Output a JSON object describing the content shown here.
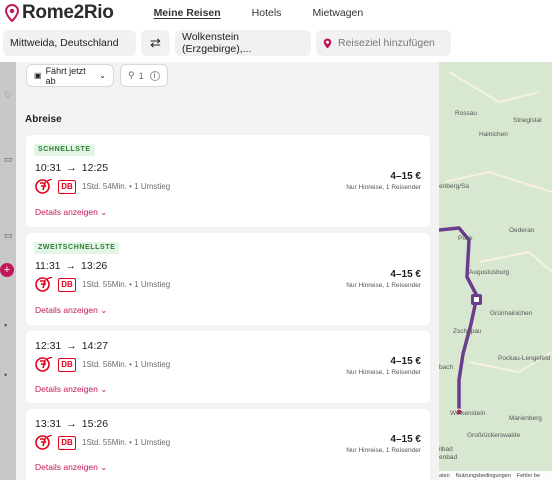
{
  "brand": {
    "name": "Rome2Rio"
  },
  "nav": {
    "items": [
      "Meine Reisen",
      "Hotels",
      "Mietwagen"
    ]
  },
  "search": {
    "origin": "Mittweida, Deutschland",
    "destination": "Wolkenstein (Erzgebirge),...",
    "add_placeholder": "Reiseziel hinzufügen"
  },
  "filters": {
    "depart": "Fährt jetzt ab",
    "passengers": "1"
  },
  "section": {
    "title": "Abreise"
  },
  "routes": [
    {
      "badge": "SCHNELLSTE",
      "dep": "10:31",
      "arr": "12:25",
      "operator": "DB",
      "meta": "1Std. 54Min. • 1 Umstieg",
      "price": "4–15 €",
      "price_sub": "Nur Hinreise, 1 Reisender",
      "details": "Details anzeigen"
    },
    {
      "badge": "ZWEITSCHNELLSTE",
      "dep": "11:31",
      "arr": "13:26",
      "operator": "DB",
      "meta": "1Std. 55Min. • 1 Umstieg",
      "price": "4–15 €",
      "price_sub": "Nur Hinreise, 1 Reisender",
      "details": "Details anzeigen"
    },
    {
      "badge": "",
      "dep": "12:31",
      "arr": "14:27",
      "operator": "DB",
      "meta": "1Std. 56Min. • 1 Umstieg",
      "price": "4–15 €",
      "price_sub": "Nur Hinreise, 1 Reisender",
      "details": "Details anzeigen"
    },
    {
      "badge": "",
      "dep": "13:31",
      "arr": "15:26",
      "operator": "DB",
      "meta": "1Std. 55Min. • 1 Umstieg",
      "price": "4–15 €",
      "price_sub": "Nur Hinreise, 1 Reisender",
      "details": "Details anzeigen"
    }
  ],
  "map": {
    "labels": [
      "Rossau",
      "Hainichen",
      "Striegistal",
      "Oederan",
      "Augustusburg",
      "Grünhainichen",
      "Pockau-Lengefeld",
      "Zschopau",
      "Wolkenstein",
      "Marienberg",
      "Großrückerswalde",
      "enberg/Sa",
      "Pock",
      "bach",
      "ilbad",
      "enbad"
    ],
    "footer": [
      "aten",
      "Nutzungsbedingungen",
      "Fehler be"
    ]
  },
  "colors": {
    "accent": "#c2185b",
    "route": "#6a3d8f",
    "db_red": "#e2001a",
    "badge_green": "#2e7d32"
  }
}
